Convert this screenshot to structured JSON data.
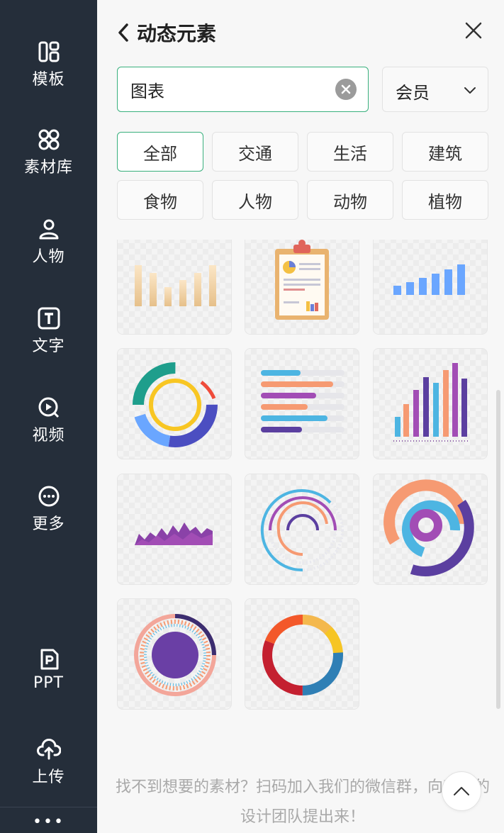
{
  "sidebar": {
    "items": [
      {
        "label": "模板",
        "icon": "template-icon"
      },
      {
        "label": "素材库",
        "icon": "material-library-icon"
      },
      {
        "label": "人物",
        "icon": "person-icon"
      },
      {
        "label": "文字",
        "icon": "text-icon"
      },
      {
        "label": "视频",
        "icon": "video-icon"
      },
      {
        "label": "更多",
        "icon": "more-icon"
      },
      {
        "label": "PPT",
        "icon": "ppt-icon"
      },
      {
        "label": "上传",
        "icon": "upload-icon"
      }
    ],
    "bottom_more": "•••"
  },
  "panel": {
    "title": "动态元素",
    "search": {
      "value": "图表",
      "placeholder": ""
    },
    "member_select": {
      "value": "会员"
    },
    "tags": [
      "全部",
      "交通",
      "生活",
      "建筑",
      "食物",
      "人物",
      "动物",
      "植物"
    ],
    "active_tag": "全部",
    "footer_note": "找不到想要的素材？扫码加入我们的微信群，向我们的设计团队提出来！"
  },
  "colors": {
    "sidebar_bg": "#252e3a",
    "accent": "#39b07d",
    "panel_bg": "#f7f7f7"
  }
}
